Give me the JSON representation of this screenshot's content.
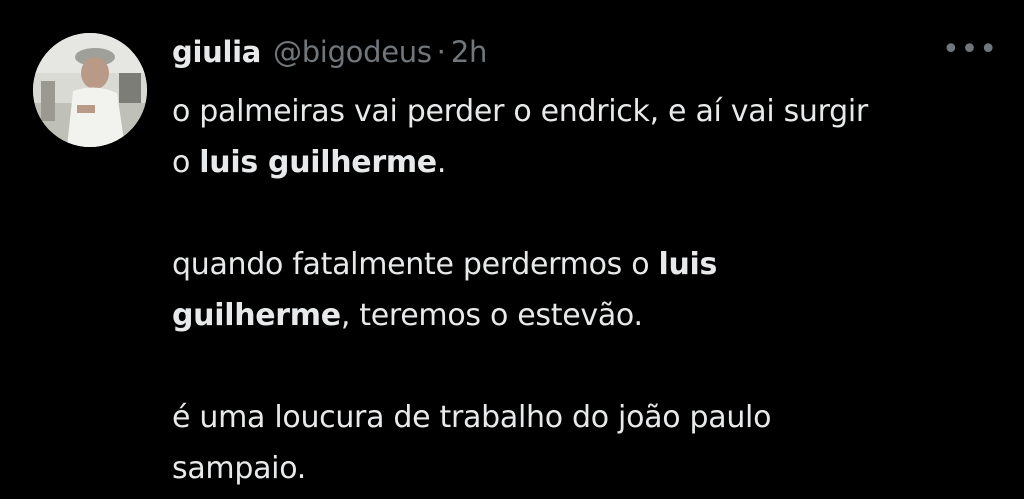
{
  "tweet": {
    "author": {
      "display_name": "giulia",
      "handle": "@bigodeus",
      "separator": "·",
      "time": "2h",
      "avatar": "profile-photo"
    },
    "more_icon": "ellipsis-icon",
    "more_glyph": "•••",
    "paragraphs": [
      {
        "line1": "o palmeiras vai perder o endrick, e aí vai surgir",
        "pre": "o ",
        "bold": "luis guilherme",
        "post": "."
      },
      {
        "line1_pre": "quando fatalmente perdermos o ",
        "line1_bold": "luis",
        "line2_bold": "guilherme",
        "line2_post": ", teremos o estevão."
      },
      {
        "line1": "é uma loucura de trabalho do joão paulo",
        "line2": "sampaio."
      }
    ]
  },
  "colors": {
    "background": "#000000",
    "text_primary": "#e7e9ea",
    "text_secondary": "#71767b"
  }
}
